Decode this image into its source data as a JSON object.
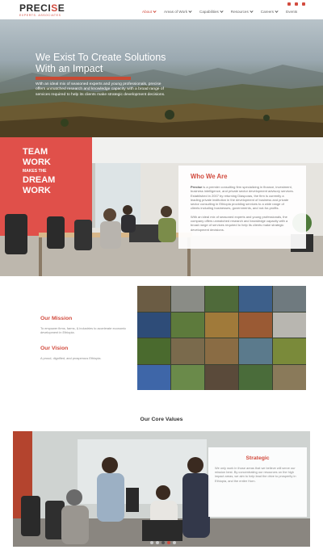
{
  "brand": {
    "name_pre": "PRECI",
    "name_accent": "S",
    "name_post": "E",
    "tagline": "EXPERTS. ASSOCIATES"
  },
  "social": [
    "linkedin-icon",
    "facebook-icon",
    "youtube-icon"
  ],
  "nav": [
    {
      "label": "About",
      "dropdown": true,
      "active": true
    },
    {
      "label": "Areas of Work",
      "dropdown": true,
      "active": false
    },
    {
      "label": "Capabilities",
      "dropdown": true,
      "active": false
    },
    {
      "label": "Resources",
      "dropdown": true,
      "active": false
    },
    {
      "label": "Careers",
      "dropdown": true,
      "active": false
    },
    {
      "label": "Events",
      "dropdown": false,
      "active": false
    }
  ],
  "hero": {
    "title_line1": "We Exist To Create Solutions",
    "title_line2": "With an Impact",
    "text": "With an ideal mix of seasoned experts and young professionals, precise offers unmatched research and knowledge capacity with a broad range of services required to help its clients make strategic development decisions."
  },
  "who": {
    "wall_line1": "TEAM",
    "wall_line2": "WORK",
    "wall_line3": "MAKES THE",
    "wall_line4": "DREAM",
    "wall_line5": "WORK",
    "title": "Who We Are",
    "p1_bold": "Precise",
    "p1": " is a premier consulting firm specializing in finance, investment, business intelligence, and private sector development advisory services. Established in 2007 by returning Diasporas, the firm is currently a leading private institution in the development of business and private sector consulting in Ethiopia providing services to a wide range of clients including businesses, governments, and not-for-profits.",
    "p2": "With an ideal mix of seasoned experts and young professionals, the company offers unmatched research and knowledge capacity with a broad range of services required to help its clients make strategic development decisions."
  },
  "mission": {
    "mission_title": "Our Mission",
    "mission_text": "To empower firms, farms, & industries to accelerate economic development in Ethiopia.",
    "vision_title": "Our Vision",
    "vision_text": "A proud, dignified, and prosperous Ethiopia."
  },
  "core_values": {
    "title": "Our Core Values",
    "card_title": "Strategic",
    "card_text": "We only work in those areas that we believe will serve our mission best. By concentrating our resources on the high impact areas, we aim to help lead the drive to prosperity in Ethiopia, and the entire Horn.",
    "dots": 5,
    "active_dot": 3
  },
  "colors": {
    "accent": "#d24b3e",
    "hero_rule": "#c94a33"
  }
}
